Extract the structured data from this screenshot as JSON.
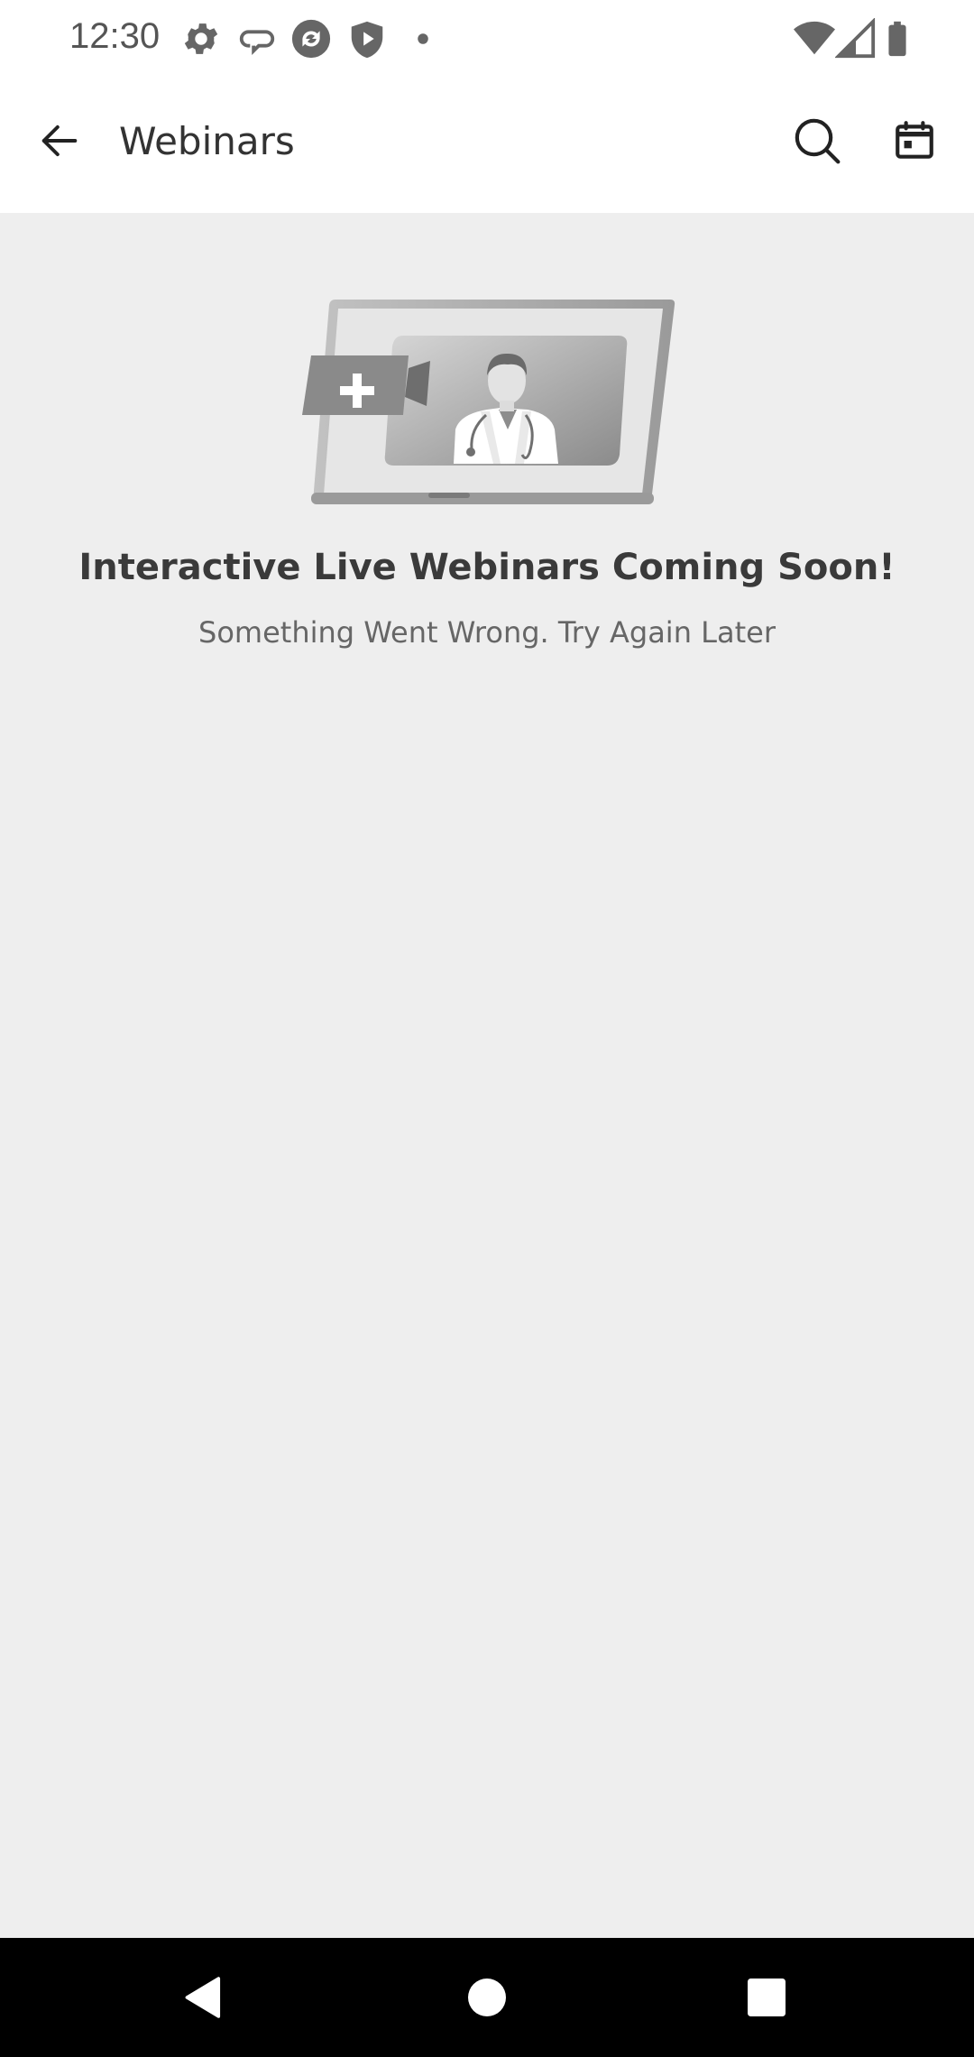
{
  "status_bar": {
    "time": "12:30",
    "icons_left": [
      "gear-icon",
      "link-icon",
      "sync-icon",
      "shield-play-icon",
      "dot-icon"
    ],
    "icons_right": [
      "wifi-icon",
      "cellular-signal-icon",
      "battery-icon"
    ]
  },
  "app_bar": {
    "title": "Webinars",
    "back_icon": "arrow-left-icon",
    "actions": [
      "search-icon",
      "calendar-icon"
    ]
  },
  "empty_state": {
    "illustration": "laptop-doctor-video-illustration",
    "title": "Interactive Live Webinars Coming Soon!",
    "subtitle": "Something Went Wrong. Try Again Later"
  },
  "nav_bar": {
    "buttons": [
      "back-triangle-icon",
      "home-circle-icon",
      "recents-square-icon"
    ]
  },
  "colors": {
    "app_bar_bg": "#ffffff",
    "content_bg": "#eeeeee",
    "nav_bar_bg": "#000000",
    "title_text": "#3a3a3a",
    "subtitle_text": "#666666"
  }
}
